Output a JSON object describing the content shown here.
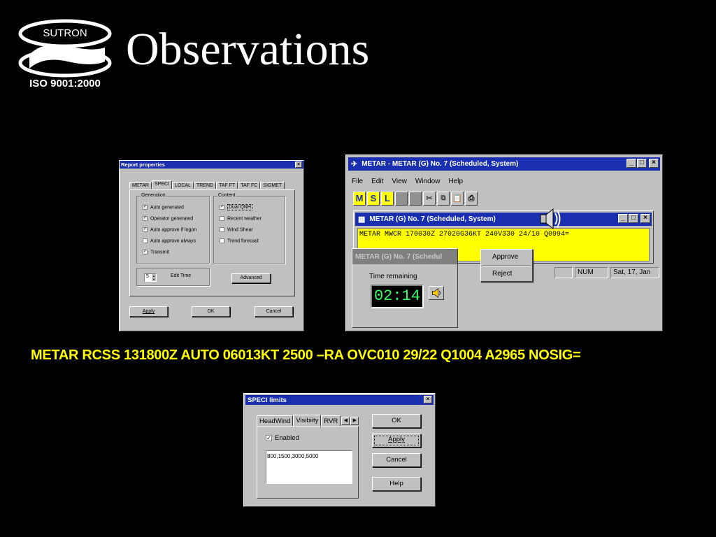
{
  "logo": {
    "brand": "SUTRON",
    "certification": "ISO 9001:2000"
  },
  "slide": {
    "title": "Observations",
    "metar_caption": "METAR RCSS 131800Z AUTO 06013KT 2500 –RA OVC010 29/22 Q1004 A2965 NOSIG="
  },
  "report_properties": {
    "title": "Report properties",
    "tabs": [
      "METAR",
      "SPECI",
      "LOCAL",
      "TREND",
      "TAF FT",
      "TAF FC",
      "SIGMET"
    ],
    "active_tab": "SPECI",
    "generation": {
      "label": "Generation",
      "items": [
        {
          "label": "Auto generated",
          "checked": true
        },
        {
          "label": "Operator generated",
          "checked": true
        },
        {
          "label": "Auto approve if logon",
          "checked": true
        },
        {
          "label": "Auto approve always",
          "checked": false
        },
        {
          "label": "Transmit",
          "checked": true
        }
      ]
    },
    "content": {
      "label": "Content",
      "items": [
        {
          "label": "Dual QNH",
          "checked": true
        },
        {
          "label": "Recent weather",
          "checked": false
        },
        {
          "label": "Wind Shear",
          "checked": false
        },
        {
          "label": "Trend forecast",
          "checked": false
        }
      ]
    },
    "edit_time_value": "5",
    "edit_time_label": "Edit Time",
    "advanced_label": "Advanced",
    "apply_label": "Apply",
    "ok_label": "OK",
    "cancel_label": "Cancel",
    "close_glyph": "×"
  },
  "metar_app": {
    "title": "METAR - METAR (G) No. 7   (Scheduled, System)",
    "menu": [
      "File",
      "Edit",
      "View",
      "Window",
      "Help"
    ],
    "toolbar": [
      "M",
      "S",
      "L"
    ],
    "child_title": "METAR (G) No. 7   (Scheduled, System)",
    "report_text": "METAR MWCR 170030Z 27020G36KT 240V330 24/10 Q0994=",
    "status_num": "NUM",
    "status_date": "Sat, 17, Jan",
    "window_buttons": [
      "_",
      "□",
      "×"
    ]
  },
  "time_dialog": {
    "title": "METAR (G) No. 7   (Schedul",
    "label": "Time remaining",
    "time": "02:14"
  },
  "context_menu": {
    "approve": "Approve",
    "reject": "Reject"
  },
  "speci_limits": {
    "title": "SPECI limits",
    "tabs": [
      "HeadWind",
      "Visibiity",
      "RVR"
    ],
    "active_tab": "Visibiity",
    "enabled_label": "Enabled",
    "enabled_checked": true,
    "values": "800,1500,3000,5000",
    "ok_label": "OK",
    "apply_label": "Apply",
    "cancel_label": "Cancel",
    "help_label": "Help"
  },
  "colors": {
    "titlebar": "#1a2fb0",
    "report_bg": "#ffff00",
    "caption": "#ffff00",
    "timer": "#33ff66"
  }
}
